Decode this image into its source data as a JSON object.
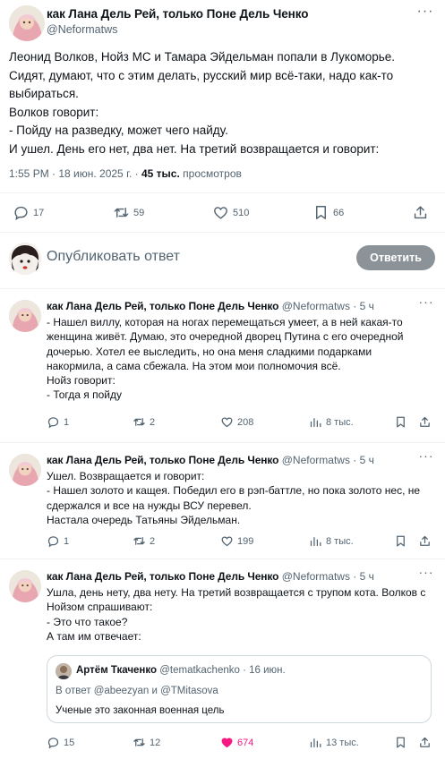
{
  "colors": {
    "text_primary": "#0f1419",
    "text_secondary": "#536471",
    "divider": "#eff3f4",
    "like_active": "#f91880",
    "reply_button_disabled": "#8b9298"
  },
  "main_tweet": {
    "author_name": "как Лана Дель Рей, только Поне Дель Ченко",
    "author_handle": "@Neformatws",
    "body_lines": [
      "Леонид Волков, Нойз МС и Тамара Эйдельман попали в Лукоморье.",
      "Сидят, думают, что с этим делать, русский мир всё-таки, надо как-то",
      "выбираться.",
      "Волков говорит:",
      "- Пойду на разведку, может чего найду.",
      "И ушел. День его нет, два нет. На третий возвращается и говорит:"
    ],
    "timestamp": "1:55 PM · 18 июн. 2025 г. · ",
    "views_count": "45 тыс.",
    "views_label": " просмотров",
    "stats": {
      "replies": "17",
      "reposts": "59",
      "likes": "510",
      "bookmarks": "66"
    },
    "icons": [
      "reply-icon",
      "repost-icon",
      "like-icon",
      "bookmark-icon",
      "share-icon",
      "more-icon"
    ]
  },
  "composer": {
    "placeholder": "Опубликовать ответ",
    "button_label": "Ответить"
  },
  "replies": [
    {
      "author_name": "как Лана Дель Рей, только Поне Дель Ченко",
      "author_handle": "@Neformatws",
      "dot": " · ",
      "time": "5 ч",
      "body_lines": [
        "- Нашел виллу, которая на ногах перемещаться умеет, а в ней какая-то",
        "женщина живёт. Думаю, это очередной дворец Путина с его очередной",
        "дочерью. Хотел ее выследить, но она меня сладкими подарками",
        "накормила, а сама сбежала. На этом мои полномочия всё.",
        "Нойз говорит:",
        "- Тогда я пойду"
      ],
      "stats": {
        "replies": "1",
        "reposts": "2",
        "likes": "208",
        "views": "8 тыс."
      }
    },
    {
      "author_name": "как Лана Дель Рей, только Поне Дель Ченко",
      "author_handle": "@Neformatws",
      "dot": " · ",
      "time": "5 ч",
      "body_lines": [
        "Ушел. Возвращается и говорит:",
        "- Нашел золото и кащея. Победил его в рэп-баттле, но пока золото нес, не",
        "сдержался и все на нужды ВСУ перевел.",
        "Настала очередь Татьяны Эйдельман."
      ],
      "stats": {
        "replies": "1",
        "reposts": "2",
        "likes": "199",
        "views": "8 тыс."
      }
    },
    {
      "author_name": "как Лана Дель Рей, только Поне Дель Ченко",
      "author_handle": "@Neformatws",
      "dot": " · ",
      "time": "5 ч",
      "body_lines": [
        "Ушла, день нету, два нету. На третий возвращается с трупом кота. Волков с",
        "Нойзом спрашивают:",
        "- Это что такое?",
        "А там им отвечает:"
      ],
      "quote": {
        "author_name": "Артём Ткаченко",
        "author_handle": "@tematkachenko · 16 июн.",
        "context": "В ответ @abeezyan и @TMitasova",
        "text": "Ученые это законная военная цель"
      },
      "stats": {
        "replies": "15",
        "reposts": "12",
        "likes": "674",
        "views": "13 тыс."
      }
    }
  ]
}
